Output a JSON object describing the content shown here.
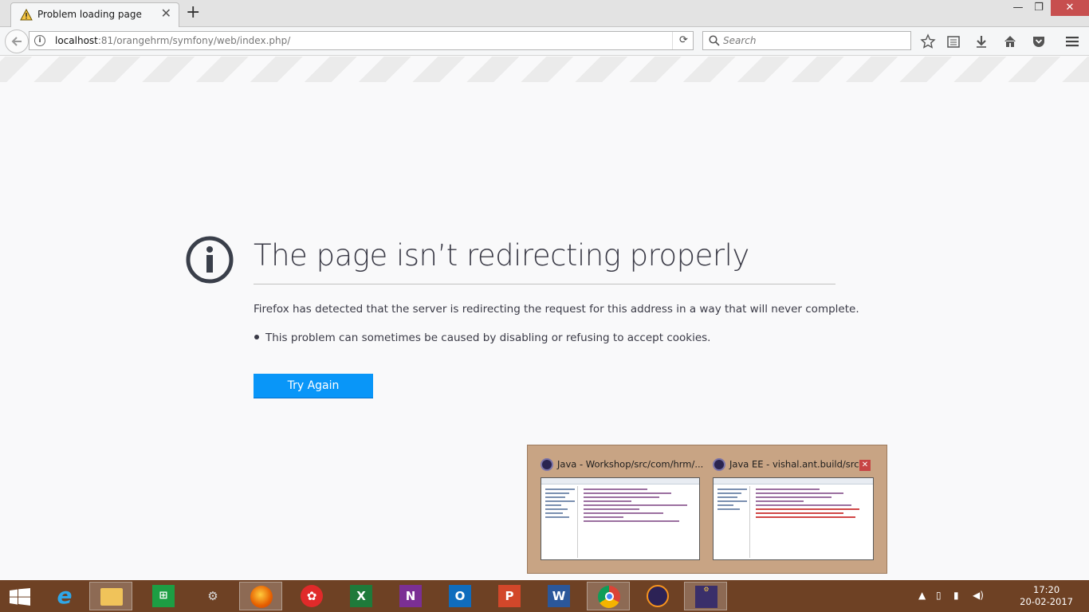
{
  "browser": {
    "tab": {
      "title": "Problem loading page",
      "close": "✕"
    },
    "new_tab": "+",
    "window": {
      "minimize": "—",
      "restore": "❐",
      "close": "✕"
    },
    "url": {
      "host": "localhost",
      "rest": ":81/orangehrm/symfony/web/index.php/"
    },
    "search_placeholder": "Search"
  },
  "error": {
    "title": "The page isn’t redirecting properly",
    "description": "Firefox has detected that the server is redirecting the request for this address in a way that will never complete.",
    "bullet": "This problem can sometimes be caused by disabling or refusing to accept cookies.",
    "button": "Try Again"
  },
  "taskbar_popup": {
    "thumbs": [
      {
        "title": "Java - Workshop/src/com/hrm/..."
      },
      {
        "title": "Java EE - vishal.ant.build/src..."
      }
    ]
  },
  "taskbar": {
    "items": [
      "start-icon",
      "internet-explorer-icon",
      "file-explorer-icon",
      "store-icon",
      "remote-desktop-icon",
      "firefox-icon",
      "app-icon",
      "excel-icon",
      "onenote-icon",
      "outlook-icon",
      "powerpoint-icon",
      "word-icon",
      "chrome-icon",
      "eclipse-icon",
      "eclipse-ee-icon"
    ],
    "clock": {
      "time": "17:20",
      "date": "20-02-2017"
    }
  },
  "colors": {
    "accent": "#0996f8",
    "taskbar": "#6e4124",
    "popup": "#c8a484"
  }
}
